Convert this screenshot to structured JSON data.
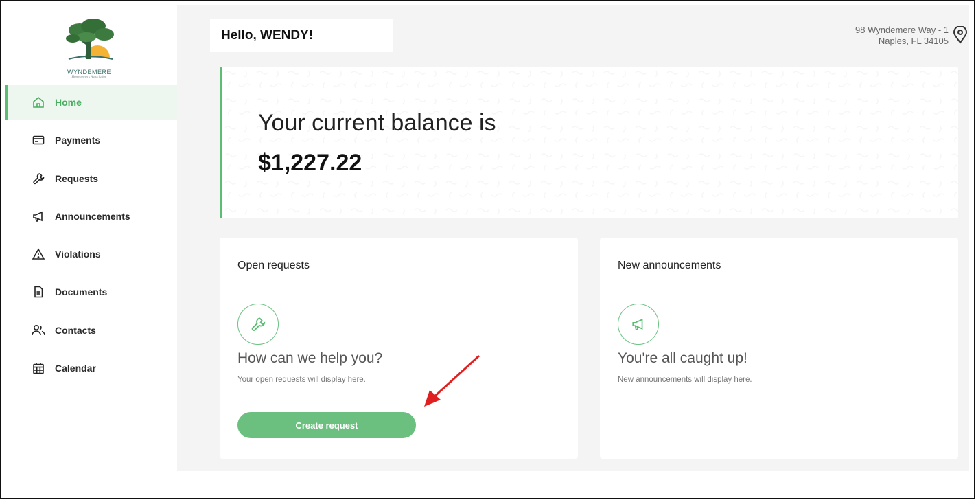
{
  "logo": {
    "name": "WYNDEMERE",
    "subtitle": "Homeowners Association"
  },
  "sidebar": {
    "items": [
      {
        "label": "Home",
        "icon": "home-icon",
        "active": true
      },
      {
        "label": "Payments",
        "icon": "credit-card-icon",
        "active": false
      },
      {
        "label": "Requests",
        "icon": "wrench-icon",
        "active": false
      },
      {
        "label": "Announcements",
        "icon": "megaphone-icon",
        "active": false
      },
      {
        "label": "Violations",
        "icon": "warning-icon",
        "active": false
      },
      {
        "label": "Documents",
        "icon": "document-icon",
        "active": false
      },
      {
        "label": "Contacts",
        "icon": "contacts-icon",
        "active": false
      },
      {
        "label": "Calendar",
        "icon": "calendar-icon",
        "active": false
      }
    ]
  },
  "header": {
    "greeting": "Hello, WENDY!",
    "address_line1": "98 Wyndemere Way - 1",
    "address_line2": "Naples, FL 34105"
  },
  "balance": {
    "label": "Your current balance is",
    "amount": "$1,227.22"
  },
  "open_requests": {
    "title": "Open requests",
    "heading": "How can we help you?",
    "subtext": "Your open requests will display here.",
    "button_label": "Create request"
  },
  "announcements": {
    "title": "New announcements",
    "heading": "You're all caught up!",
    "subtext": "New announcements will display here."
  },
  "colors": {
    "accent": "#5bbd72",
    "button": "#6cc07f",
    "annotation_arrow": "#e02020"
  }
}
